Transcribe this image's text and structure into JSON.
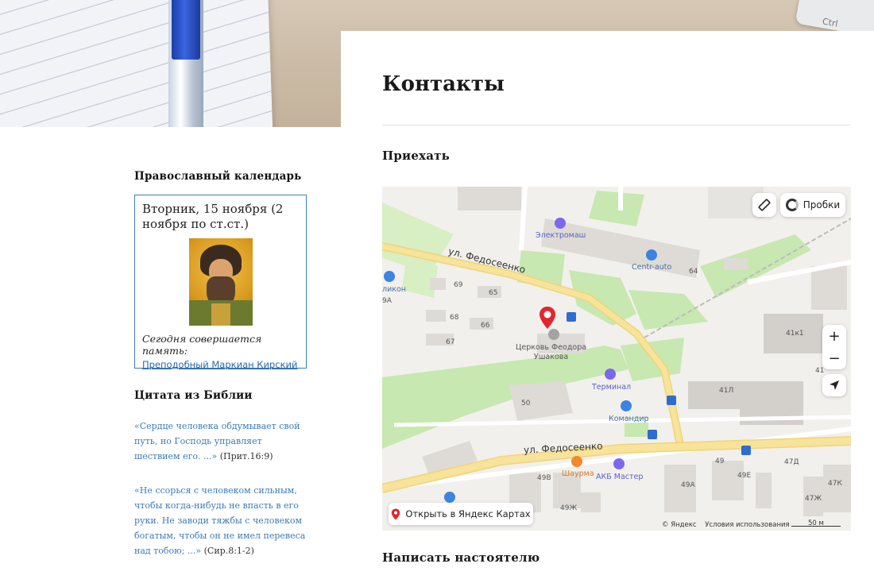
{
  "hero": {
    "keyboard_label": "Ctrl"
  },
  "sidebar": {
    "calendar": {
      "title": "Православный календарь",
      "date": "Вторник, 15 ноября (2 ноября по ст.ст.)",
      "memory_label": "Сегодня совершается память:",
      "saint_link": "Преподобный Маркиан Кирский"
    },
    "bible": {
      "title": "Цитата из Библии",
      "quotes": [
        {
          "text": "«Сердце человека обдумывает свой путь, но Господь управляет шествием его. ...»",
          "ref": "(Прит.16:9)"
        },
        {
          "text": "«Не ссорься с человеком сильным, чтобы когда-нибудь не впасть в его руки. Не заводи тяжбы с человеком богатым, чтобы он не имел перевеса над тобою; ...»",
          "ref": "(Сир.8:1-2)"
        }
      ]
    }
  },
  "main": {
    "title": "Контакты",
    "section_arrive": "Приехать",
    "section_write": "Написать настоятелю"
  },
  "map": {
    "traffic_label": "Пробки",
    "open_label": "Открыть в Яндекс Картах",
    "copyright": "© Яндекс",
    "terms": "Условия использования",
    "scale": "50 м",
    "zoom_in": "+",
    "zoom_out": "−",
    "streets": {
      "top": "ул. Федосеенко",
      "bottom": "ул. Федосеенко"
    },
    "pois": {
      "elektromash": "Электромаш",
      "centr_auto": "Centr-auto",
      "likon": "ликон",
      "terminal": "Терминал",
      "komandir": "Командир",
      "shaurma": "Шаурма",
      "akb": "АКБ Мастер",
      "church_line1": "Церковь Феодора",
      "church_line2": "Ушакова"
    },
    "houses": {
      "h69": "69",
      "h65": "65",
      "h68": "68",
      "h66": "66",
      "h67": "67",
      "h64": "64",
      "h9a": "9А",
      "h41k1": "41к1",
      "h41": "41",
      "h41l": "41Л",
      "h50": "50",
      "h49": "49",
      "h49v": "49В",
      "h49a": "49А",
      "h49e": "49Е",
      "h47d": "47Д",
      "h47k": "47К",
      "h47zh": "47Ж",
      "h49zh": "49Ж"
    },
    "colors": {
      "road": "#f7df8a",
      "green": "#c7e8b0",
      "building": "#dedbd6",
      "pin": "#e3262e"
    }
  }
}
